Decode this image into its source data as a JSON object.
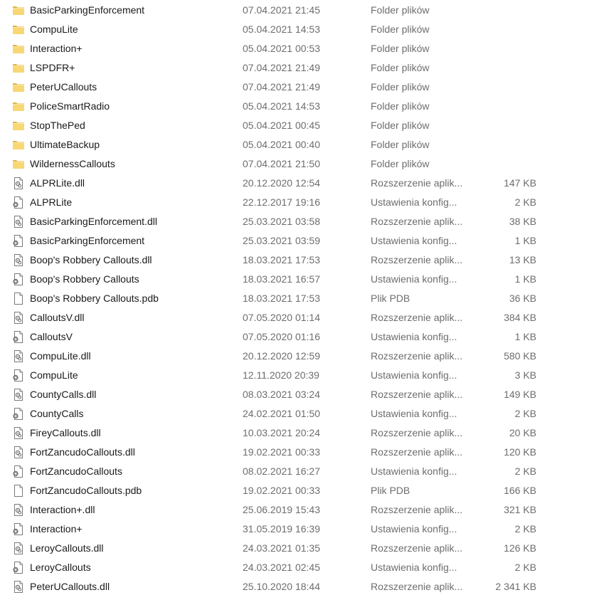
{
  "files": [
    {
      "name": "BasicParkingEnforcement",
      "date": "07.04.2021 21:45",
      "type": "Folder plików",
      "size": "",
      "icon": "folder-icon"
    },
    {
      "name": "CompuLite",
      "date": "05.04.2021 14:53",
      "type": "Folder plików",
      "size": "",
      "icon": "folder-icon"
    },
    {
      "name": "Interaction+",
      "date": "05.04.2021 00:53",
      "type": "Folder plików",
      "size": "",
      "icon": "folder-icon"
    },
    {
      "name": "LSPDFR+",
      "date": "07.04.2021 21:49",
      "type": "Folder plików",
      "size": "",
      "icon": "folder-icon"
    },
    {
      "name": "PeterUCallouts",
      "date": "07.04.2021 21:49",
      "type": "Folder plików",
      "size": "",
      "icon": "folder-icon"
    },
    {
      "name": "PoliceSmartRadio",
      "date": "05.04.2021 14:53",
      "type": "Folder plików",
      "size": "",
      "icon": "folder-icon"
    },
    {
      "name": "StopThePed",
      "date": "05.04.2021 00:45",
      "type": "Folder plików",
      "size": "",
      "icon": "folder-icon"
    },
    {
      "name": "UltimateBackup",
      "date": "05.04.2021 00:40",
      "type": "Folder plików",
      "size": "",
      "icon": "folder-icon"
    },
    {
      "name": "WildernessCallouts",
      "date": "07.04.2021 21:50",
      "type": "Folder plików",
      "size": "",
      "icon": "folder-icon"
    },
    {
      "name": "ALPRLite.dll",
      "date": "20.12.2020 12:54",
      "type": "Rozszerzenie aplik...",
      "size": "147 KB",
      "icon": "dll-file-icon"
    },
    {
      "name": "ALPRLite",
      "date": "22.12.2017 19:16",
      "type": "Ustawienia konfig...",
      "size": "2 KB",
      "icon": "config-file-icon"
    },
    {
      "name": "BasicParkingEnforcement.dll",
      "date": "25.03.2021 03:58",
      "type": "Rozszerzenie aplik...",
      "size": "38 KB",
      "icon": "dll-file-icon"
    },
    {
      "name": "BasicParkingEnforcement",
      "date": "25.03.2021 03:59",
      "type": "Ustawienia konfig...",
      "size": "1 KB",
      "icon": "config-file-icon"
    },
    {
      "name": "Boop's Robbery Callouts.dll",
      "date": "18.03.2021 17:53",
      "type": "Rozszerzenie aplik...",
      "size": "13 KB",
      "icon": "dll-file-icon"
    },
    {
      "name": "Boop's Robbery Callouts",
      "date": "18.03.2021 16:57",
      "type": "Ustawienia konfig...",
      "size": "1 KB",
      "icon": "config-file-icon"
    },
    {
      "name": "Boop's Robbery Callouts.pdb",
      "date": "18.03.2021 17:53",
      "type": "Plik PDB",
      "size": "36 KB",
      "icon": "blank-file-icon"
    },
    {
      "name": "CalloutsV.dll",
      "date": "07.05.2020 01:14",
      "type": "Rozszerzenie aplik...",
      "size": "384 KB",
      "icon": "dll-file-icon"
    },
    {
      "name": "CalloutsV",
      "date": "07.05.2020 01:16",
      "type": "Ustawienia konfig...",
      "size": "1 KB",
      "icon": "config-file-icon"
    },
    {
      "name": "CompuLite.dll",
      "date": "20.12.2020 12:59",
      "type": "Rozszerzenie aplik...",
      "size": "580 KB",
      "icon": "dll-file-icon"
    },
    {
      "name": "CompuLite",
      "date": "12.11.2020 20:39",
      "type": "Ustawienia konfig...",
      "size": "3 KB",
      "icon": "config-file-icon"
    },
    {
      "name": "CountyCalls.dll",
      "date": "08.03.2021 03:24",
      "type": "Rozszerzenie aplik...",
      "size": "149 KB",
      "icon": "dll-file-icon"
    },
    {
      "name": "CountyCalls",
      "date": "24.02.2021 01:50",
      "type": "Ustawienia konfig...",
      "size": "2 KB",
      "icon": "config-file-icon"
    },
    {
      "name": "FireyCallouts.dll",
      "date": "10.03.2021 20:24",
      "type": "Rozszerzenie aplik...",
      "size": "20 KB",
      "icon": "dll-file-icon"
    },
    {
      "name": "FortZancudoCallouts.dll",
      "date": "19.02.2021 00:33",
      "type": "Rozszerzenie aplik...",
      "size": "120 KB",
      "icon": "dll-file-icon"
    },
    {
      "name": "FortZancudoCallouts",
      "date": "08.02.2021 16:27",
      "type": "Ustawienia konfig...",
      "size": "2 KB",
      "icon": "config-file-icon"
    },
    {
      "name": "FortZancudoCallouts.pdb",
      "date": "19.02.2021 00:33",
      "type": "Plik PDB",
      "size": "166 KB",
      "icon": "blank-file-icon"
    },
    {
      "name": "Interaction+.dll",
      "date": "25.06.2019 15:43",
      "type": "Rozszerzenie aplik...",
      "size": "321 KB",
      "icon": "dll-file-icon"
    },
    {
      "name": "Interaction+",
      "date": "31.05.2019 16:39",
      "type": "Ustawienia konfig...",
      "size": "2 KB",
      "icon": "config-file-icon"
    },
    {
      "name": "LeroyCallouts.dll",
      "date": "24.03.2021 01:35",
      "type": "Rozszerzenie aplik...",
      "size": "126 KB",
      "icon": "dll-file-icon"
    },
    {
      "name": "LeroyCallouts",
      "date": "24.03.2021 02:45",
      "type": "Ustawienia konfig...",
      "size": "2 KB",
      "icon": "config-file-icon"
    },
    {
      "name": "PeterUCallouts.dll",
      "date": "25.10.2020 18:44",
      "type": "Rozszerzenie aplik...",
      "size": "2 341 KB",
      "icon": "dll-file-icon"
    }
  ],
  "colors": {
    "folder": "#f8d775",
    "folder_dark": "#e0b440",
    "text_primary": "#1a1a1a",
    "text_secondary": "#6d6d6d"
  }
}
